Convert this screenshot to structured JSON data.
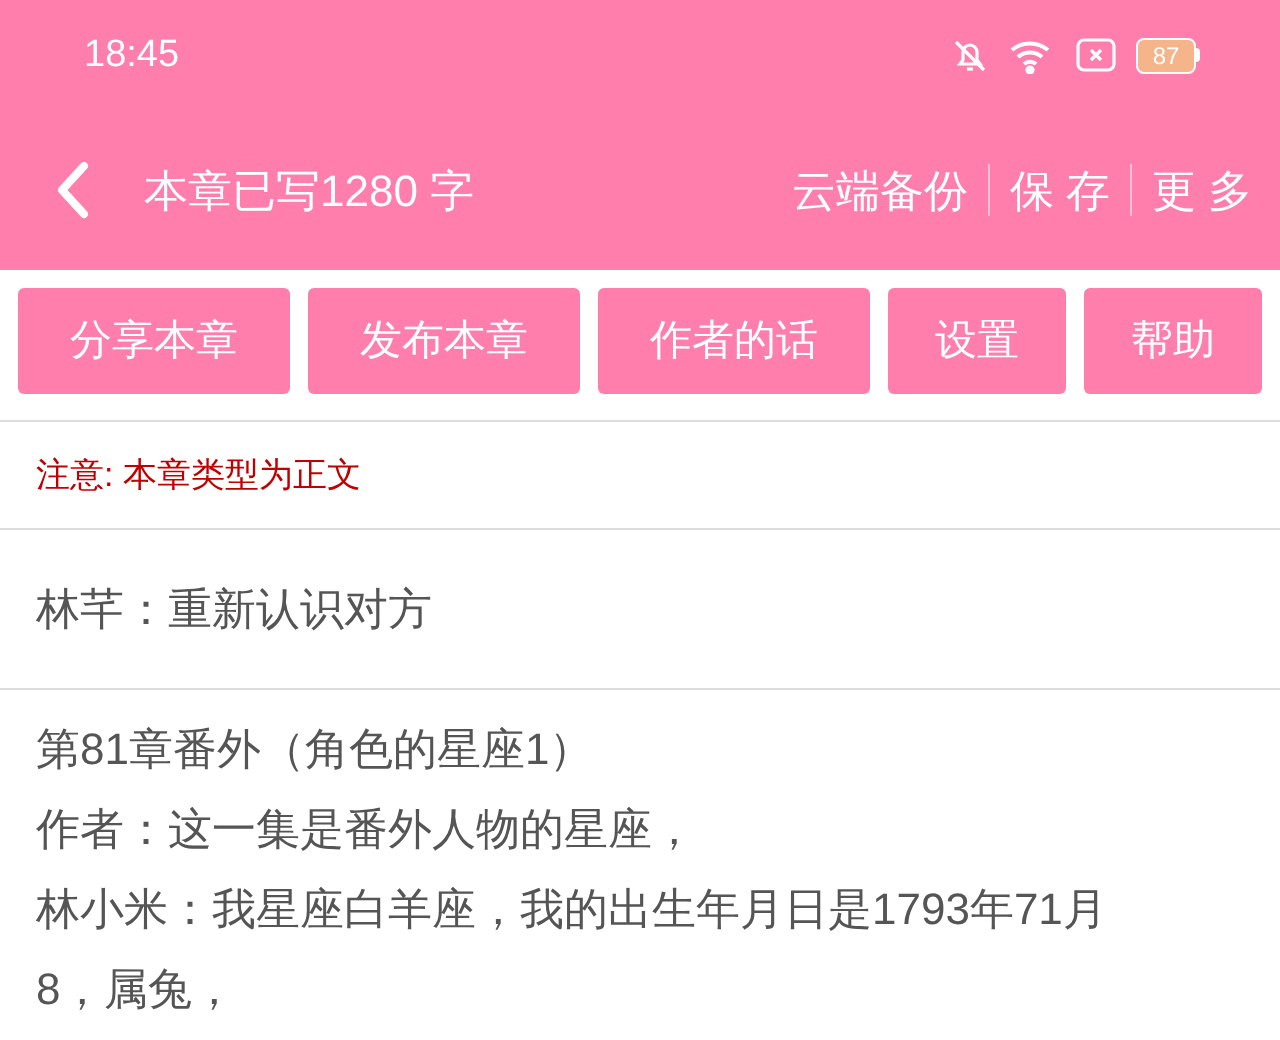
{
  "status_bar": {
    "time": "18:45",
    "battery": "87"
  },
  "toolbar": {
    "title": "本章已写1280 字",
    "actions": [
      "云端备份",
      "保 存",
      "更 多"
    ]
  },
  "buttons": [
    "分享本章",
    "发布本章",
    "作者的话",
    "设置",
    "帮助"
  ],
  "notice": "注意: 本章类型为正文",
  "chapter_title": "林芊：重新认识对方",
  "body": [
    "第81章番外（角色的星座1）",
    "作者：这一集是番外人物的星座，",
    "林小米：我星座白羊座，我的出生年月日是1793年71月8，属兔，"
  ]
}
